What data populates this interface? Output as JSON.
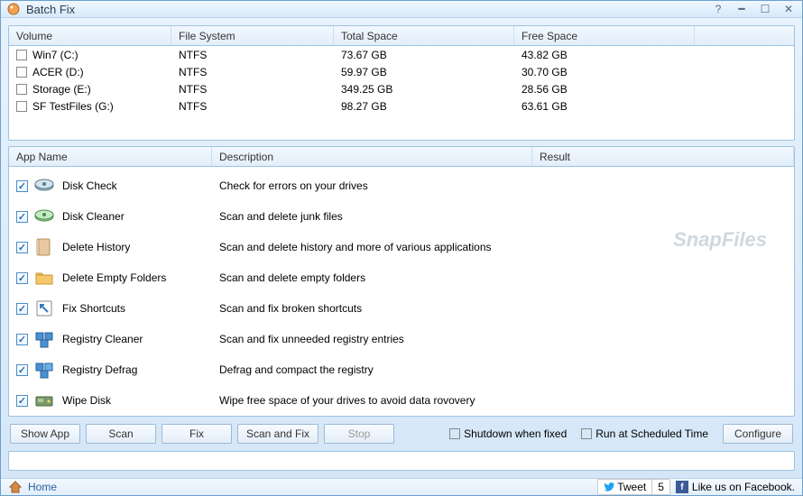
{
  "window": {
    "title": "Batch Fix"
  },
  "volumes": {
    "headers": {
      "volume": "Volume",
      "filesystem": "File System",
      "total": "Total Space",
      "free": "Free Space"
    },
    "rows": [
      {
        "name": "Win7 (C:)",
        "fs": "NTFS",
        "total": "73.67 GB",
        "free": "43.82 GB"
      },
      {
        "name": "ACER (D:)",
        "fs": "NTFS",
        "total": "59.97 GB",
        "free": "30.70 GB"
      },
      {
        "name": "Storage (E:)",
        "fs": "NTFS",
        "total": "349.25 GB",
        "free": "28.56 GB"
      },
      {
        "name": "SF TestFiles (G:)",
        "fs": "NTFS",
        "total": "98.27 GB",
        "free": "63.61 GB"
      }
    ]
  },
  "apps": {
    "headers": {
      "name": "App Name",
      "desc": "Description",
      "result": "Result"
    },
    "rows": [
      {
        "name": "Disk Check",
        "desc": "Check for errors on your drives",
        "icon": "disk-check"
      },
      {
        "name": "Disk Cleaner",
        "desc": "Scan and delete junk files",
        "icon": "disk-cleaner"
      },
      {
        "name": "Delete History",
        "desc": "Scan and delete history and more of various applications",
        "icon": "delete-history"
      },
      {
        "name": "Delete Empty Folders",
        "desc": "Scan and delete empty folders",
        "icon": "delete-empty-folders"
      },
      {
        "name": "Fix Shortcuts",
        "desc": "Scan and fix broken shortcuts",
        "icon": "fix-shortcuts"
      },
      {
        "name": "Registry Cleaner",
        "desc": "Scan and fix unneeded registry entries",
        "icon": "registry-cleaner"
      },
      {
        "name": "Registry Defrag",
        "desc": "Defrag and compact the registry",
        "icon": "registry-defrag"
      },
      {
        "name": "Wipe Disk",
        "desc": "Wipe free space of your drives to avoid data rovovery",
        "icon": "wipe-disk"
      }
    ]
  },
  "buttons": {
    "show_app": "Show App",
    "scan": "Scan",
    "fix": "Fix",
    "scan_and_fix": "Scan and Fix",
    "stop": "Stop",
    "configure": "Configure"
  },
  "options": {
    "shutdown": "Shutdown when fixed",
    "scheduled": "Run at Scheduled Time"
  },
  "statusbar": {
    "home": "Home",
    "tweet_label": "Tweet",
    "tweet_count": "5",
    "facebook": "Like us on Facebook."
  },
  "watermark": "SnapFiles"
}
